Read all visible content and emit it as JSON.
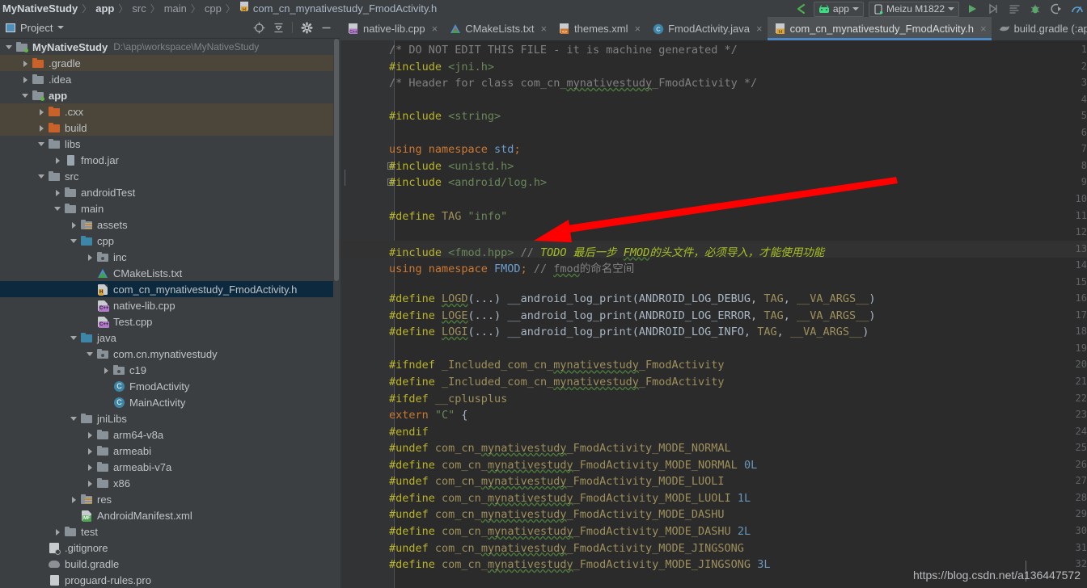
{
  "breadcrumb": {
    "items": [
      {
        "label": "MyNativeStudy",
        "style": "bold"
      },
      {
        "label": "app",
        "style": "bold"
      },
      {
        "label": "src",
        "style": "dim"
      },
      {
        "label": "main",
        "style": "dim"
      },
      {
        "label": "cpp",
        "style": "dim"
      },
      {
        "label": "com_cn_mynativestudy_FmodActivity.h",
        "style": "file"
      }
    ]
  },
  "toolbar": {
    "back_icon": "back-arrow-icon",
    "module_selector": "app",
    "device_selector": "Meizu M1822",
    "run_icon": "run-icon",
    "apply_changes_icon": "apply-changes-icon",
    "logcat_icon": "logcat-icon",
    "debug_icon": "debug-icon",
    "attach_debugger_icon": "attach-debugger-icon",
    "profiler_icon": "profiler-icon"
  },
  "project_panel": {
    "title": "Project",
    "actions": [
      "locate-icon",
      "collapse-all-icon",
      "settings-gear-icon",
      "hide-icon"
    ],
    "tree": [
      {
        "indent": 0,
        "arrow": "down",
        "icon": "folder-module",
        "label": "MyNativeStudy",
        "bold": true,
        "path": "D:\\app\\workspace\\MyNativeStudy",
        "row": "normal"
      },
      {
        "indent": 1,
        "arrow": "right",
        "icon": "folder-orange",
        "label": ".gradle",
        "row": "tan"
      },
      {
        "indent": 1,
        "arrow": "right",
        "icon": "folder-gray",
        "label": ".idea",
        "row": "normal"
      },
      {
        "indent": 1,
        "arrow": "down",
        "icon": "folder-module",
        "label": "app",
        "bold": true,
        "row": "normal"
      },
      {
        "indent": 2,
        "arrow": "right",
        "icon": "folder-orange",
        "label": ".cxx",
        "row": "tan"
      },
      {
        "indent": 2,
        "arrow": "right",
        "icon": "folder-orange",
        "label": "build",
        "row": "tan"
      },
      {
        "indent": 2,
        "arrow": "down",
        "icon": "folder-gray",
        "label": "libs",
        "row": "normal"
      },
      {
        "indent": 3,
        "arrow": "right",
        "icon": "jar",
        "label": "fmod.jar",
        "row": "normal"
      },
      {
        "indent": 2,
        "arrow": "down",
        "icon": "folder-gray",
        "label": "src",
        "row": "normal"
      },
      {
        "indent": 3,
        "arrow": "right",
        "icon": "folder-gray",
        "label": "androidTest",
        "row": "normal"
      },
      {
        "indent": 3,
        "arrow": "down",
        "icon": "folder-gray",
        "label": "main",
        "row": "normal"
      },
      {
        "indent": 4,
        "arrow": "right",
        "icon": "folder-res",
        "label": "assets",
        "row": "normal"
      },
      {
        "indent": 4,
        "arrow": "down",
        "icon": "folder-blue",
        "label": "cpp",
        "row": "normal"
      },
      {
        "indent": 5,
        "arrow": "right",
        "icon": "folder-pkg",
        "label": "inc",
        "row": "normal"
      },
      {
        "indent": 5,
        "arrow": "none",
        "icon": "cmake",
        "label": "CMakeLists.txt",
        "row": "normal"
      },
      {
        "indent": 5,
        "arrow": "none",
        "icon": "header-h",
        "label": "com_cn_mynativestudy_FmodActivity.h",
        "row": "selected"
      },
      {
        "indent": 5,
        "arrow": "none",
        "icon": "cpp",
        "label": "native-lib.cpp",
        "row": "normal"
      },
      {
        "indent": 5,
        "arrow": "none",
        "icon": "cpp",
        "label": "Test.cpp",
        "row": "normal"
      },
      {
        "indent": 4,
        "arrow": "down",
        "icon": "folder-blue",
        "label": "java",
        "row": "normal"
      },
      {
        "indent": 5,
        "arrow": "down",
        "icon": "folder-pkg",
        "label": "com.cn.mynativestudy",
        "row": "normal"
      },
      {
        "indent": 6,
        "arrow": "right",
        "icon": "folder-pkg",
        "label": "c19",
        "row": "normal"
      },
      {
        "indent": 6,
        "arrow": "none",
        "icon": "class",
        "label": "FmodActivity",
        "row": "normal"
      },
      {
        "indent": 6,
        "arrow": "none",
        "icon": "class",
        "label": "MainActivity",
        "row": "normal"
      },
      {
        "indent": 4,
        "arrow": "down",
        "icon": "folder-gray",
        "label": "jniLibs",
        "row": "normal"
      },
      {
        "indent": 5,
        "arrow": "right",
        "icon": "folder-gray",
        "label": "arm64-v8a",
        "row": "normal"
      },
      {
        "indent": 5,
        "arrow": "right",
        "icon": "folder-gray",
        "label": "armeabi",
        "row": "normal"
      },
      {
        "indent": 5,
        "arrow": "right",
        "icon": "folder-gray",
        "label": "armeabi-v7a",
        "row": "normal"
      },
      {
        "indent": 5,
        "arrow": "right",
        "icon": "folder-gray",
        "label": "x86",
        "row": "normal"
      },
      {
        "indent": 4,
        "arrow": "right",
        "icon": "folder-res",
        "label": "res",
        "row": "normal"
      },
      {
        "indent": 4,
        "arrow": "none",
        "icon": "manifest",
        "label": "AndroidManifest.xml",
        "row": "normal"
      },
      {
        "indent": 3,
        "arrow": "right",
        "icon": "folder-gray",
        "label": "test",
        "row": "normal"
      },
      {
        "indent": 2,
        "arrow": "none",
        "icon": "gitignore",
        "label": ".gitignore",
        "row": "normal"
      },
      {
        "indent": 2,
        "arrow": "none",
        "icon": "gradle",
        "label": "build.gradle",
        "row": "normal"
      },
      {
        "indent": 2,
        "arrow": "none",
        "icon": "pro",
        "label": "proguard-rules.pro",
        "row": "normal"
      }
    ]
  },
  "editor": {
    "tabs": [
      {
        "label": "native-lib.cpp",
        "icon": "cpp-file-icon",
        "active": false,
        "closable": true
      },
      {
        "label": "CMakeLists.txt",
        "icon": "cmake-file-icon",
        "active": false,
        "closable": true
      },
      {
        "label": "themes.xml",
        "icon": "xml-file-icon",
        "active": false,
        "closable": true
      },
      {
        "label": "FmodActivity.java",
        "icon": "java-class-icon",
        "active": false,
        "closable": true
      },
      {
        "label": "com_cn_mynativestudy_FmodActivity.h",
        "icon": "header-file-icon",
        "active": true,
        "closable": true
      },
      {
        "label": "build.gradle (:app",
        "icon": "gradle-file-icon",
        "active": false,
        "closable": false
      }
    ],
    "first_line_number": 1,
    "last_line_number": 32,
    "highlighted_line": 13,
    "lines": [
      {
        "n": 1,
        "segments": [
          {
            "t": "/* DO NOT EDIT THIS FILE - it is machine generated */",
            "c": "c-com"
          }
        ]
      },
      {
        "n": 2,
        "segments": [
          {
            "t": "#include ",
            "c": "c-mac"
          },
          {
            "t": "<jni.h>",
            "c": "c-str"
          }
        ]
      },
      {
        "n": 3,
        "segments": [
          {
            "t": "/* Header for class com_cn_",
            "c": "c-com"
          },
          {
            "t": "mynativestudy",
            "c": "c-com squig"
          },
          {
            "t": "_FmodActivity */",
            "c": "c-com"
          }
        ]
      },
      {
        "n": 4,
        "segments": []
      },
      {
        "n": 5,
        "segments": [
          {
            "t": "#include ",
            "c": "c-mac"
          },
          {
            "t": "<string>",
            "c": "c-str"
          }
        ]
      },
      {
        "n": 6,
        "segments": []
      },
      {
        "n": 7,
        "segments": [
          {
            "t": "using namespace ",
            "c": "c-kw"
          },
          {
            "t": "std",
            "c": "c-ns"
          },
          {
            "t": ";",
            "c": "c-kw"
          }
        ]
      },
      {
        "n": 8,
        "segments": [
          {
            "t": "#include ",
            "c": "c-mac"
          },
          {
            "t": "<unistd.h>",
            "c": "c-str"
          }
        ],
        "fold": "start"
      },
      {
        "n": 9,
        "segments": [
          {
            "t": "#include ",
            "c": "c-mac"
          },
          {
            "t": "<android/log.h>",
            "c": "c-str"
          }
        ],
        "fold": "end"
      },
      {
        "n": 10,
        "segments": []
      },
      {
        "n": 11,
        "segments": [
          {
            "t": "#define ",
            "c": "c-mac"
          },
          {
            "t": "TAG ",
            "c": "c-const"
          },
          {
            "t": "\"info\"",
            "c": "c-str"
          }
        ]
      },
      {
        "n": 12,
        "segments": []
      },
      {
        "n": 13,
        "segments": [
          {
            "t": "#include ",
            "c": "c-mac"
          },
          {
            "t": "<fmod.hpp> ",
            "c": "c-str"
          },
          {
            "t": "// ",
            "c": "c-com"
          },
          {
            "t": "TODO 最后一步 ",
            "c": "c-todo"
          },
          {
            "t": "FMOD",
            "c": "c-todo squig"
          },
          {
            "t": "的头文件，必须导入，才能使用功能",
            "c": "c-todo"
          }
        ]
      },
      {
        "n": 14,
        "segments": [
          {
            "t": "using namespace ",
            "c": "c-kw"
          },
          {
            "t": "FMOD",
            "c": "c-ns"
          },
          {
            "t": "; ",
            "c": "c-kw"
          },
          {
            "t": "// ",
            "c": "c-com"
          },
          {
            "t": "fmod",
            "c": "c-com squig"
          },
          {
            "t": "的命名空间",
            "c": "c-com"
          }
        ]
      },
      {
        "n": 15,
        "segments": []
      },
      {
        "n": 16,
        "segments": [
          {
            "t": "#define ",
            "c": "c-mac"
          },
          {
            "t": "LOGD",
            "c": "c-const squig"
          },
          {
            "t": "(...) ",
            "c": "c-txt"
          },
          {
            "t": "__android_log_print(ANDROID_LOG_DEBUG, ",
            "c": "c-txt"
          },
          {
            "t": "TAG",
            "c": "c-const"
          },
          {
            "t": ", ",
            "c": "c-txt"
          },
          {
            "t": "__VA_ARGS__",
            "c": "c-const"
          },
          {
            "t": ")",
            "c": "c-txt"
          }
        ]
      },
      {
        "n": 17,
        "segments": [
          {
            "t": "#define ",
            "c": "c-mac"
          },
          {
            "t": "LOGE",
            "c": "c-const squig"
          },
          {
            "t": "(...) ",
            "c": "c-txt"
          },
          {
            "t": "__android_log_print(ANDROID_LOG_ERROR, ",
            "c": "c-txt"
          },
          {
            "t": "TAG",
            "c": "c-const"
          },
          {
            "t": ", ",
            "c": "c-txt"
          },
          {
            "t": "__VA_ARGS__",
            "c": "c-const"
          },
          {
            "t": ")",
            "c": "c-txt"
          }
        ]
      },
      {
        "n": 18,
        "segments": [
          {
            "t": "#define ",
            "c": "c-mac"
          },
          {
            "t": "LOGI",
            "c": "c-const squig"
          },
          {
            "t": "(...) ",
            "c": "c-txt"
          },
          {
            "t": "__android_log_print(ANDROID_LOG_INFO, ",
            "c": "c-txt"
          },
          {
            "t": "TAG",
            "c": "c-const"
          },
          {
            "t": ", ",
            "c": "c-txt"
          },
          {
            "t": "__VA_ARGS__",
            "c": "c-const"
          },
          {
            "t": ")",
            "c": "c-txt"
          }
        ]
      },
      {
        "n": 19,
        "segments": []
      },
      {
        "n": 20,
        "segments": [
          {
            "t": "#ifndef ",
            "c": "c-mac"
          },
          {
            "t": "_Included_com_cn_",
            "c": "c-const"
          },
          {
            "t": "mynativestudy",
            "c": "c-const squig"
          },
          {
            "t": "_FmodActivity",
            "c": "c-const"
          }
        ]
      },
      {
        "n": 21,
        "segments": [
          {
            "t": "#define ",
            "c": "c-mac"
          },
          {
            "t": "_Included_com_cn_",
            "c": "c-const"
          },
          {
            "t": "mynativestudy",
            "c": "c-const squig"
          },
          {
            "t": "_FmodActivity",
            "c": "c-const"
          }
        ]
      },
      {
        "n": 22,
        "segments": [
          {
            "t": "#ifdef ",
            "c": "c-mac"
          },
          {
            "t": "__cplusplus",
            "c": "c-const"
          }
        ]
      },
      {
        "n": 23,
        "segments": [
          {
            "t": "extern ",
            "c": "c-kw"
          },
          {
            "t": "\"C\"",
            "c": "c-str"
          },
          {
            "t": " {",
            "c": "c-txt"
          }
        ]
      },
      {
        "n": 24,
        "segments": [
          {
            "t": "#endif",
            "c": "c-mac"
          }
        ]
      },
      {
        "n": 25,
        "segments": [
          {
            "t": "#undef ",
            "c": "c-mac"
          },
          {
            "t": "com_cn_",
            "c": "c-const"
          },
          {
            "t": "mynativestudy",
            "c": "c-const squig"
          },
          {
            "t": "_FmodActivity_MODE_NORMAL",
            "c": "c-const"
          }
        ]
      },
      {
        "n": 26,
        "segments": [
          {
            "t": "#define ",
            "c": "c-mac"
          },
          {
            "t": "com_cn_",
            "c": "c-const"
          },
          {
            "t": "mynativestudy",
            "c": "c-const squig"
          },
          {
            "t": "_FmodActivity_MODE_NORMAL ",
            "c": "c-const"
          },
          {
            "t": "0L",
            "c": "c-num"
          }
        ]
      },
      {
        "n": 27,
        "segments": [
          {
            "t": "#undef ",
            "c": "c-mac"
          },
          {
            "t": "com_cn_",
            "c": "c-const"
          },
          {
            "t": "mynativestudy",
            "c": "c-const squig"
          },
          {
            "t": "_FmodActivity_MODE_LUOLI",
            "c": "c-const"
          }
        ]
      },
      {
        "n": 28,
        "segments": [
          {
            "t": "#define ",
            "c": "c-mac"
          },
          {
            "t": "com_cn_",
            "c": "c-const"
          },
          {
            "t": "mynativestudy",
            "c": "c-const squig"
          },
          {
            "t": "_FmodActivity_MODE_LUOLI ",
            "c": "c-const"
          },
          {
            "t": "1L",
            "c": "c-num"
          }
        ]
      },
      {
        "n": 29,
        "segments": [
          {
            "t": "#undef ",
            "c": "c-mac"
          },
          {
            "t": "com_cn_",
            "c": "c-const"
          },
          {
            "t": "mynativestudy",
            "c": "c-const squig"
          },
          {
            "t": "_FmodActivity_MODE_DASHU",
            "c": "c-const"
          }
        ]
      },
      {
        "n": 30,
        "segments": [
          {
            "t": "#define ",
            "c": "c-mac"
          },
          {
            "t": "com_cn_",
            "c": "c-const"
          },
          {
            "t": "mynativestudy",
            "c": "c-const squig"
          },
          {
            "t": "_FmodActivity_MODE_DASHU ",
            "c": "c-const"
          },
          {
            "t": "2L",
            "c": "c-num"
          }
        ]
      },
      {
        "n": 31,
        "segments": [
          {
            "t": "#undef ",
            "c": "c-mac"
          },
          {
            "t": "com_cn_",
            "c": "c-const"
          },
          {
            "t": "mynativestudy",
            "c": "c-const squig"
          },
          {
            "t": "_FmodActivity_MODE_JINGSONG",
            "c": "c-const"
          }
        ]
      },
      {
        "n": 32,
        "segments": [
          {
            "t": "#define ",
            "c": "c-mac"
          },
          {
            "t": "com_cn_",
            "c": "c-const"
          },
          {
            "t": "mynativestudy",
            "c": "c-const squig"
          },
          {
            "t": "_FmodActivity_MODE_JINGSONG ",
            "c": "c-const"
          },
          {
            "t": "3L",
            "c": "c-num"
          }
        ]
      }
    ]
  },
  "annotation": {
    "arrow_color": "#ff0000",
    "points_to_line": 11
  },
  "watermark": "https://blog.csdn.net/a136447572",
  "colors": {
    "accent": "#4a88c7",
    "selection": "#0d293e",
    "editor_bg": "#2b2b2b",
    "chrome_bg": "#3c3f41"
  }
}
